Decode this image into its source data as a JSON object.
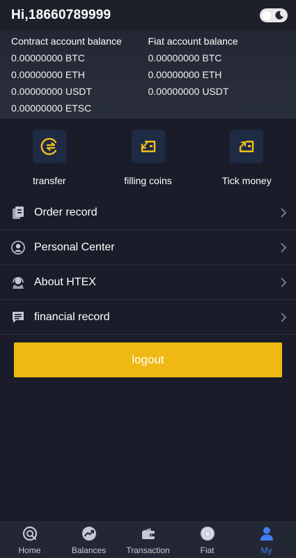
{
  "header": {
    "greeting": "Hi,18660789999"
  },
  "balances": {
    "contract": {
      "title": "Contract account balance",
      "rows": [
        "0.00000000 BTC",
        "0.00000000 ETH",
        "0.00000000 USDT",
        "0.00000000 ETSC"
      ]
    },
    "fiat": {
      "title": "Fiat account balance",
      "rows": [
        "0.00000000 BTC",
        "0.00000000 ETH",
        "0.00000000 USDT"
      ]
    }
  },
  "actions": [
    {
      "label": "transfer",
      "icon": "transfer-icon"
    },
    {
      "label": "filling coins",
      "icon": "deposit-icon"
    },
    {
      "label": "Tick money",
      "icon": "withdraw-icon"
    }
  ],
  "menu": [
    {
      "label": "Order record",
      "icon": "document-icon"
    },
    {
      "label": "Personal Center",
      "icon": "user-icon"
    },
    {
      "label": "About HTEX",
      "icon": "support-icon"
    },
    {
      "label": "financial record",
      "icon": "message-icon"
    }
  ],
  "logout_label": "logout",
  "tabs": [
    {
      "label": "Home",
      "icon": "home-icon"
    },
    {
      "label": "Balances",
      "icon": "chart-icon"
    },
    {
      "label": "Transaction",
      "icon": "wallet-icon"
    },
    {
      "label": "Fiat",
      "icon": "fiat-icon"
    },
    {
      "label": "My",
      "icon": "user-icon"
    }
  ],
  "colors": {
    "background": "#1a1d29",
    "accent": "#efb812",
    "active_tab": "#3f7df2",
    "icon_gold": "#f0c21b"
  }
}
